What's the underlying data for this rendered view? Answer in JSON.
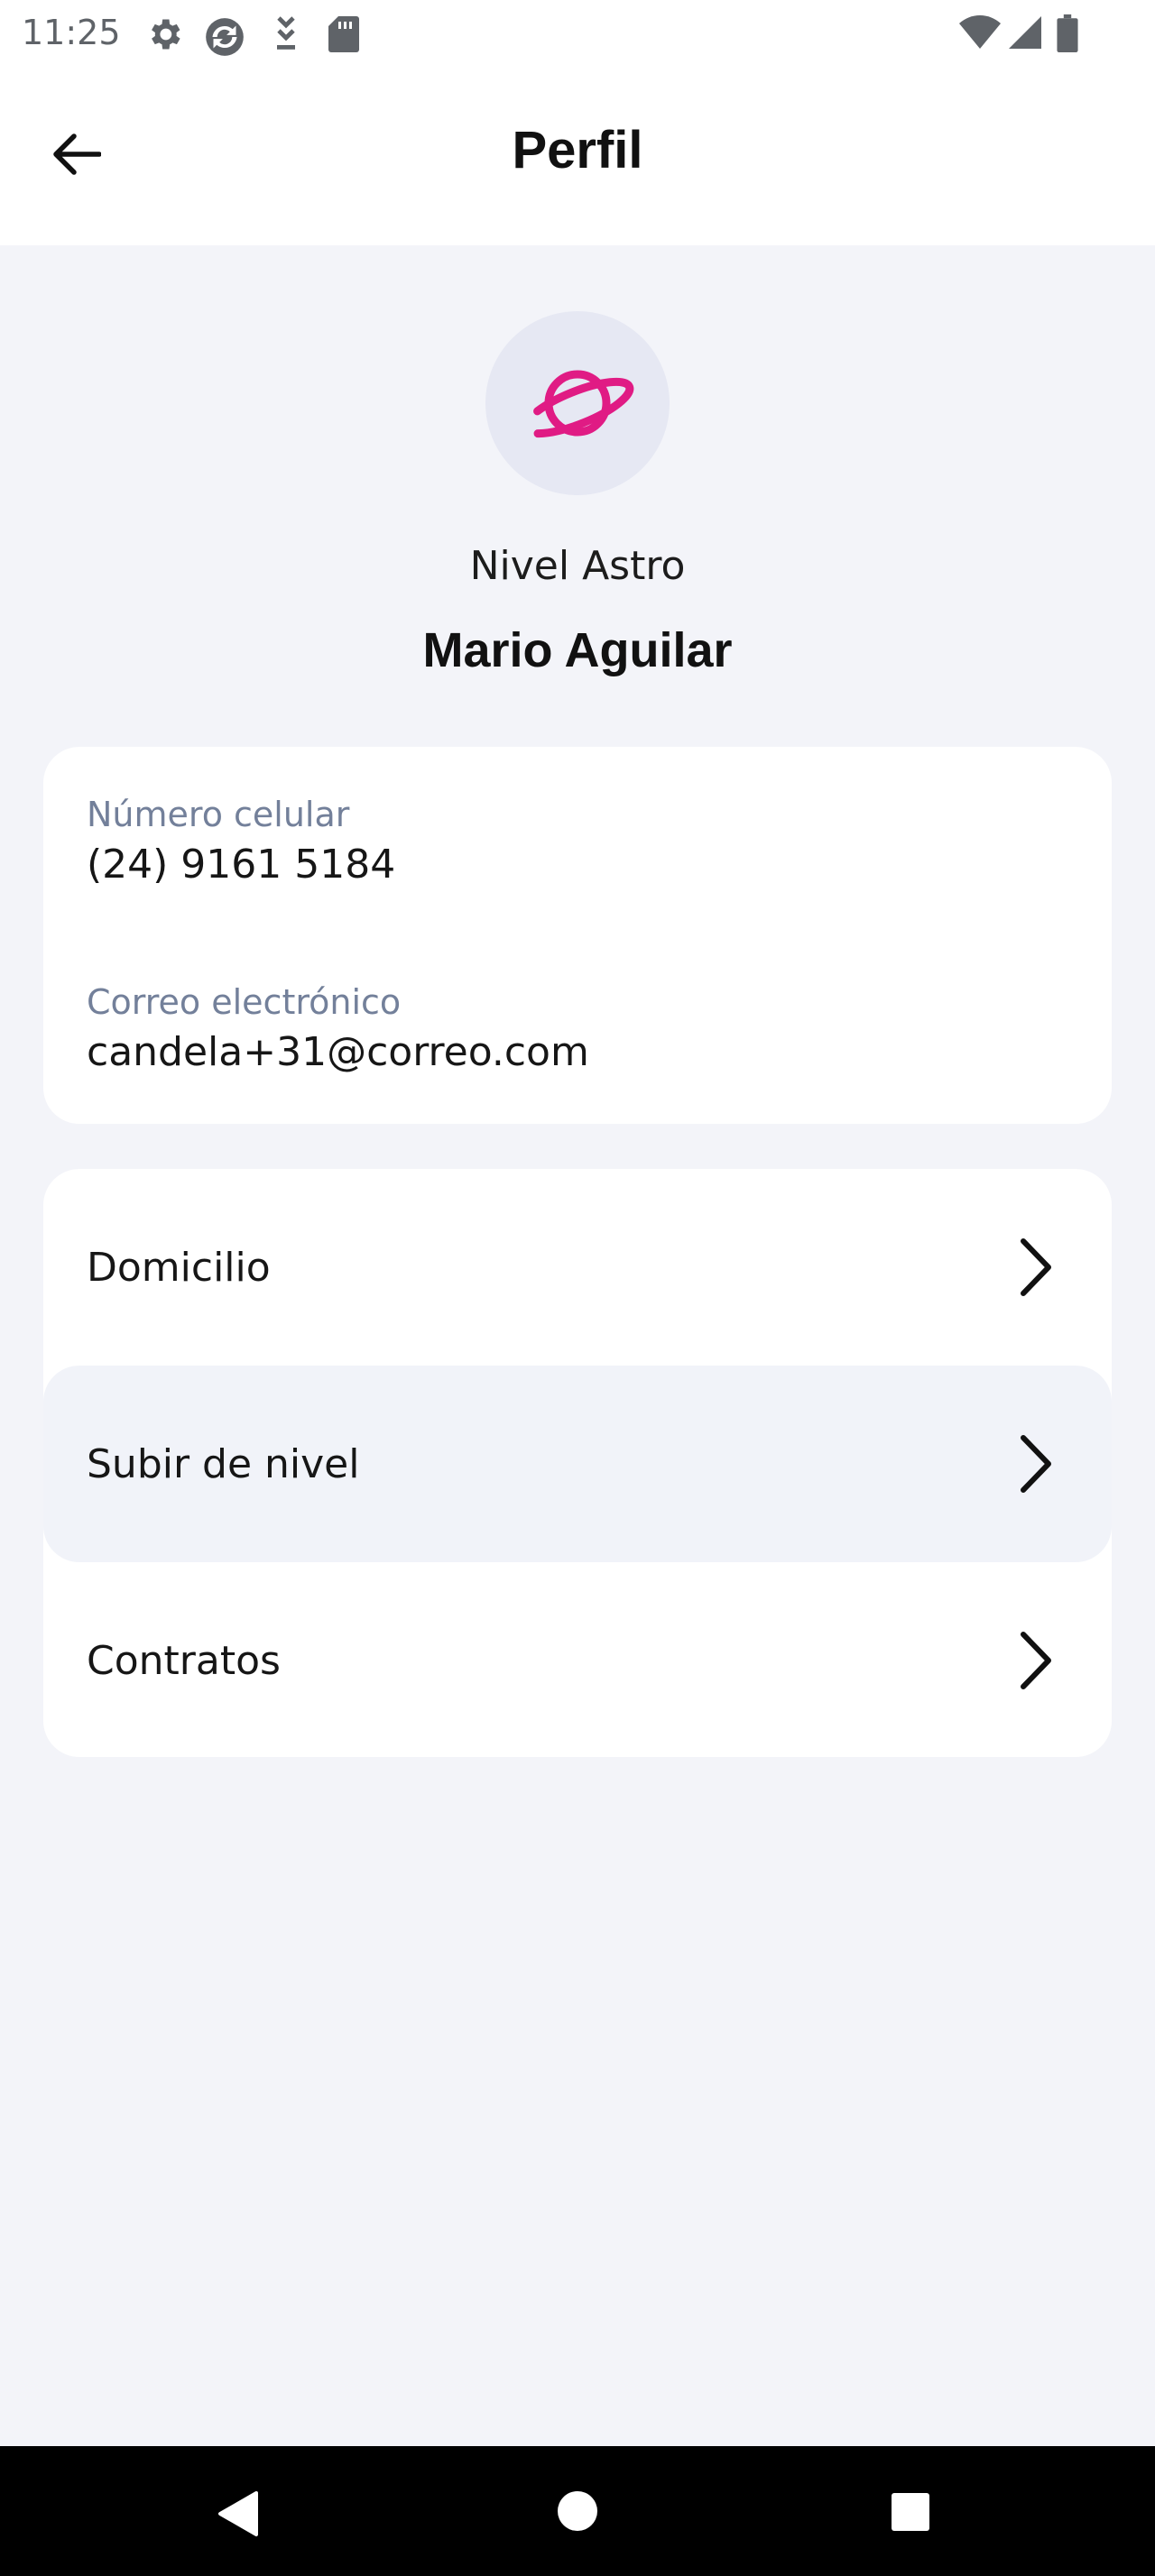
{
  "status_bar": {
    "time": "11:25",
    "icons": [
      "settings-icon",
      "sync-icon",
      "download-icon",
      "sd-card-icon",
      "wifi-icon",
      "signal-icon",
      "battery-icon"
    ]
  },
  "app_bar": {
    "title": "Perfil",
    "back_icon": "arrow-back-icon"
  },
  "profile": {
    "avatar_icon": "planet-icon",
    "level": "Nivel Astro",
    "name": "Mario Aguilar"
  },
  "contact": {
    "phone_label": "Número celular",
    "phone_value": "(24) 9161 5184",
    "email_label": "Correo electrónico",
    "email_value": "candela+31@correo.com"
  },
  "menu": {
    "items": [
      {
        "label": "Domicilio"
      },
      {
        "label": "Subir de nivel"
      },
      {
        "label": "Contratos"
      }
    ]
  },
  "nav_bar": {
    "buttons": [
      "back-triangle-icon",
      "home-circle-icon",
      "recents-square-icon"
    ]
  },
  "colors": {
    "accent": "#e01b84",
    "background": "#f3f4f9",
    "card": "#ffffff",
    "label": "#73809a"
  }
}
